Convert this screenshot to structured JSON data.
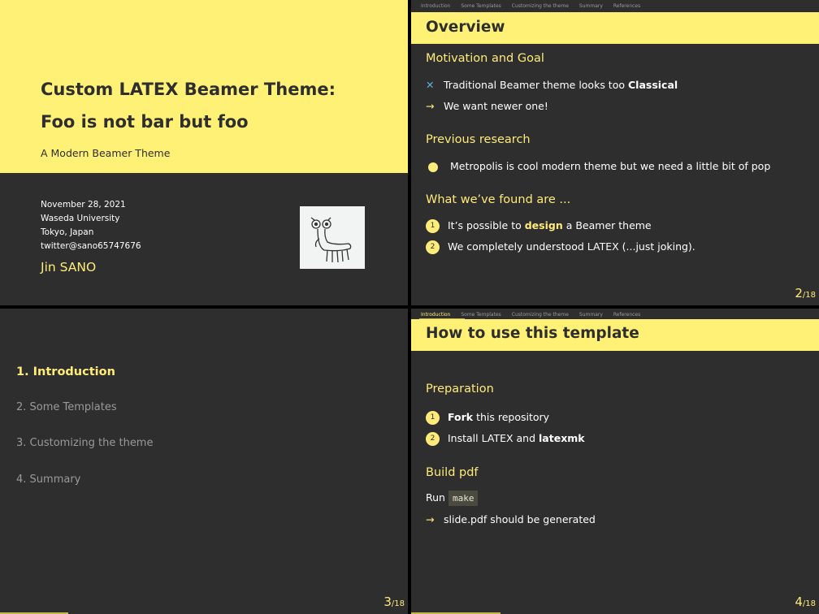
{
  "slide1": {
    "title_line1_a": "Custom ",
    "title_latex": "LATEX",
    "title_line1_b": " Beamer Theme:",
    "title_line2": "Foo is not bar but foo",
    "subtitle": "A Modern Beamer Theme",
    "date": "November 28, 2021",
    "institution1": "Waseda University",
    "institution2": "Tokyo, Japan",
    "twitter": "twitter@sano65747676",
    "author": "Jin SANO"
  },
  "nav": {
    "items": [
      "Introduction",
      "Some Templates",
      "Customizing the theme",
      "Summary",
      "References"
    ]
  },
  "slide2": {
    "title": "Overview",
    "block1_title": "Motivation and Goal",
    "b1_item1_pre": "Traditional Beamer theme looks too ",
    "b1_item1_bold": "Classical",
    "b1_item2": "We want newer one!",
    "block2_title": "Previous research",
    "b2_item1": "Metropolis is cool modern theme but we need a little bit of pop",
    "block3_title": "What we’ve found are ...",
    "b3_item1_pre": "It’s possible to ",
    "b3_item1_hl": "design",
    "b3_item1_post": " a Beamer theme",
    "b3_item2_pre": "We completely understood ",
    "b3_item2_latex": "LATEX",
    "b3_item2_post": " (...just joking).",
    "num1": "1",
    "num2": "2",
    "page": "2",
    "total": "/18"
  },
  "slide3": {
    "toc": [
      "1. Introduction",
      "2. Some Templates",
      "3. Customizing the theme",
      "4. Summary"
    ],
    "page": "3",
    "total": "/18"
  },
  "slide4": {
    "title": "How to use this template",
    "block1_title": "Preparation",
    "b1_item1_bold": "Fork",
    "b1_item1_post": " this repository",
    "b1_item2_pre": "Install ",
    "b1_item2_latex": "LATEX",
    "b1_item2_mid": " and ",
    "b1_item2_bold": "latexmk",
    "block2_title": "Build pdf",
    "run_label": "Run ",
    "run_code": "make",
    "b2_item1": "slide.pdf should be generated",
    "num1": "1",
    "num2": "2",
    "page": "4",
    "total": "/18"
  },
  "icons": {
    "arrow": "→",
    "cross": "✕"
  },
  "colors": {
    "accent": "#ffeb7a",
    "background": "#2e2e2e",
    "title_band": "#fff176"
  }
}
